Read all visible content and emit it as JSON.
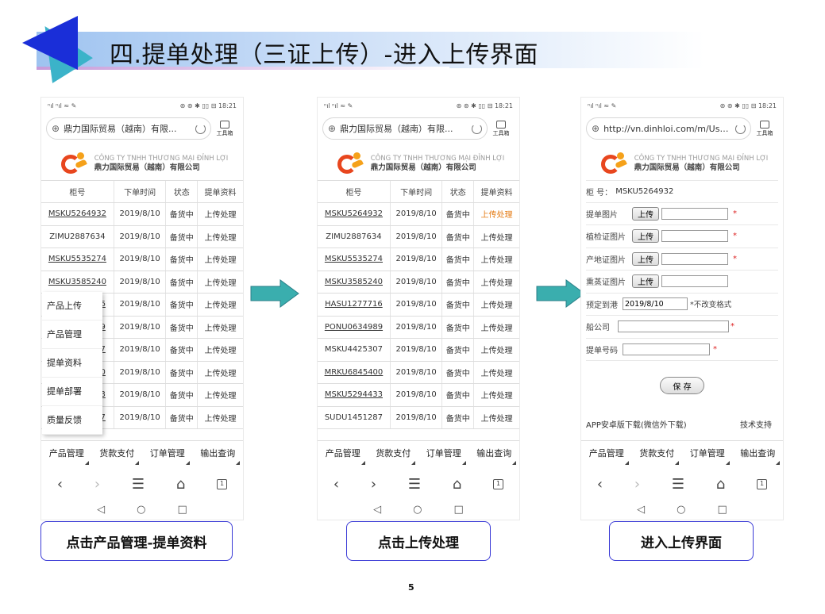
{
  "slide": {
    "title": "四.提单处理（三证上传）-进入上传界面",
    "page_number": "5",
    "colors": {
      "title_bar": "#9ec3f0",
      "triangle": "#1a2ed8",
      "arrow": "#3aaeae",
      "caption_border": "#3a3ad6",
      "highlight": "#e47a12"
    }
  },
  "phone_common": {
    "status_left": "ⁿıl ⁿıl ≈ ✎",
    "status_right": "⊛ ⊚ ✱ ▯▯ ⊟ 18:21",
    "toolbox_label": "工具箱",
    "logo_en": "CÔNG TY TNHH THƯƠNG MẠI ĐỈNH LỢI",
    "logo_cn": "鼎力国际贸易（越南）有限公司",
    "bottom_nav": [
      "产品管理",
      "货款支付",
      "订单管理",
      "输出查询"
    ],
    "browser_nav": [
      "‹",
      "›",
      "☰",
      "⌂",
      "1"
    ],
    "sys_nav": [
      "◁",
      "○",
      "□"
    ]
  },
  "phone1": {
    "url": "鼎力国际贸易（越南）有限...",
    "table_headers": [
      "柜号",
      "下单时间",
      "状态",
      "提单资料"
    ],
    "rows": [
      [
        "MSKU5264932",
        "2019/8/10",
        "备货中",
        "上传处理"
      ],
      [
        "ZIMU2887634",
        "2019/8/10",
        "备货中",
        "上传处理"
      ],
      [
        "MSKU5535274",
        "2019/8/10",
        "备货中",
        "上传处理"
      ],
      [
        "MSKU3585240",
        "2019/8/10",
        "备货中",
        "上传处理"
      ],
      [
        "6",
        "2019/8/10",
        "备货中",
        "上传处理"
      ],
      [
        "9",
        "2019/8/10",
        "备货中",
        "上传处理"
      ],
      [
        "7",
        "2019/8/10",
        "备货中",
        "上传处理"
      ],
      [
        "0",
        "2019/8/10",
        "备货中",
        "上传处理"
      ],
      [
        "3",
        "2019/8/10",
        "备货中",
        "上传处理"
      ],
      [
        "7",
        "2019/8/10",
        "备货中",
        "上传处理"
      ]
    ],
    "menu": [
      "产品上传",
      "产品管理",
      "提单资料",
      "提单部署",
      "质量反馈"
    ]
  },
  "phone2": {
    "url": "鼎力国际贸易（越南）有限...",
    "table_headers": [
      "柜号",
      "下单时间",
      "状态",
      "提单资料"
    ],
    "rows": [
      [
        "MSKU5264932",
        "2019/8/10",
        "备货中",
        "上传处理"
      ],
      [
        "ZIMU2887634",
        "2019/8/10",
        "备货中",
        "上传处理"
      ],
      [
        "MSKU5535274",
        "2019/8/10",
        "备货中",
        "上传处理"
      ],
      [
        "MSKU3585240",
        "2019/8/10",
        "备货中",
        "上传处理"
      ],
      [
        "HASU1277716",
        "2019/8/10",
        "备货中",
        "上传处理"
      ],
      [
        "PONU0634989",
        "2019/8/10",
        "备货中",
        "上传处理"
      ],
      [
        "MSKU4425307",
        "2019/8/10",
        "备货中",
        "上传处理"
      ],
      [
        "MRKU6845400",
        "2019/8/10",
        "备货中",
        "上传处理"
      ],
      [
        "MSKU5294433",
        "2019/8/10",
        "备货中",
        "上传处理"
      ],
      [
        "SUDU1451287",
        "2019/8/10",
        "备货中",
        "上传处理"
      ]
    ]
  },
  "phone3": {
    "url": "http://vn.dinhloi.com/m/Use...",
    "container_label": "柜 号：",
    "container_no": "MSKU5264932",
    "upload_label": "上传",
    "fields": {
      "bill_image": "提单图片",
      "inspection_image": "植检证图片",
      "origin_image": "产地证图片",
      "quarantine_image": "熏蒸证图片",
      "arrival_date": "预定到港",
      "arrival_date_value": "2019/8/10",
      "arrival_note": "*不改变格式",
      "shipping_company": "船公司",
      "bill_number": "提单号码"
    },
    "save_label": "保 存",
    "app_download": "APP安卓版下载(微信外下载)",
    "tech_support": "技术支持"
  },
  "captions": [
    "点击产品管理-提单资料",
    "点击上传处理",
    "进入上传界面"
  ]
}
